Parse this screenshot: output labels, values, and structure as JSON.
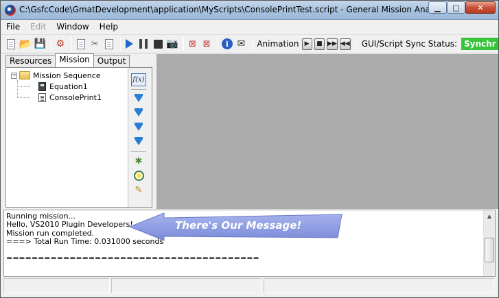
{
  "window": {
    "title": "C:\\GsfcCode\\GmatDevelopment\\application\\MyScripts\\ConsolePrintTest.script - General Mission Analysis To...",
    "min_glyph": "▁",
    "max_glyph": "□",
    "close_glyph": "✕"
  },
  "menu": [
    {
      "label": "File",
      "enabled": true
    },
    {
      "label": "Edit",
      "enabled": false
    },
    {
      "label": "Window",
      "enabled": true
    },
    {
      "label": "Help",
      "enabled": true
    }
  ],
  "toolbar": {
    "animation_label": "Animation",
    "sync_label": "GUI/Script Sync Status:",
    "sync_value": "Synchr",
    "sync_color": "#37c43a"
  },
  "tabs": [
    {
      "label": "Resources",
      "active": false
    },
    {
      "label": "Mission",
      "active": true
    },
    {
      "label": "Output",
      "active": false
    }
  ],
  "tree": {
    "root": "Mission Sequence",
    "children": [
      "Equation1",
      "ConsolePrint1"
    ]
  },
  "side_tools": {
    "fx_label": "f(x)"
  },
  "output": {
    "lines": [
      "Running mission...",
      "Hello, VS2010 Plugin Developers!",
      "Mission run completed.",
      "===> Total Run Time: 0.031000 seconds",
      "",
      "========================================"
    ]
  },
  "callout": {
    "text": "There's Our Message!",
    "color": "#8c9ce0"
  }
}
